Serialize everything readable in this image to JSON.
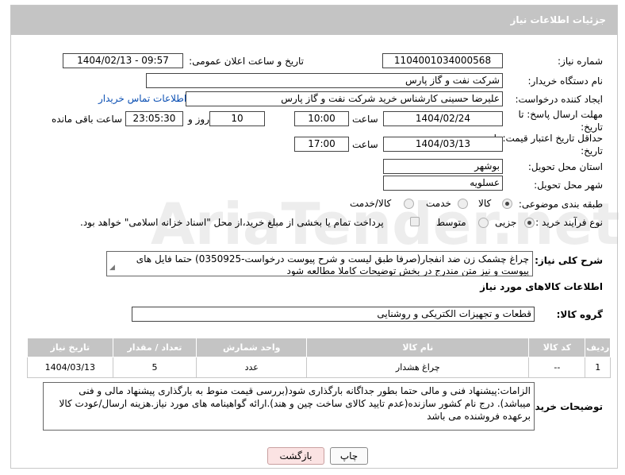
{
  "header": {
    "title": "جزئیات اطلاعات نیاز"
  },
  "watermark": {
    "text": "AriaTender.net"
  },
  "fields": {
    "need_number": {
      "label": "شماره نیاز:",
      "value": "1104001034000568"
    },
    "announce_datetime": {
      "label": "تاریخ و ساعت اعلان عمومی:",
      "value": "1404/02/13 - 09:57"
    },
    "buyer_org": {
      "label": "نام دستگاه خریدار:",
      "value": "شرکت نفت و گاز پارس"
    },
    "requester": {
      "label": "ایجاد کننده درخواست:",
      "value": "علیرضا حسینی کارشناس خرید شرکت نفت و گاز پارس",
      "contact_link": "اطلاعات تماس خریدار"
    },
    "reply_deadline": {
      "label": "مهلت ارسال پاسخ: تا تاریخ:",
      "date": "1404/02/24",
      "time_label": "ساعت",
      "time": "10:00",
      "days": "10",
      "days_label": "روز و",
      "remaining": "23:05:30",
      "remaining_label": "ساعت باقی مانده"
    },
    "price_validity": {
      "label": "حداقل تاریخ اعتبار قیمت: تا تاریخ:",
      "date": "1404/03/13",
      "time_label": "ساعت",
      "time": "17:00"
    },
    "province": {
      "label": "استان محل تحویل:",
      "value": "بوشهر"
    },
    "city": {
      "label": "شهر محل تحویل:",
      "value": "عسلویه"
    },
    "category": {
      "label": "طبقه بندی موضوعی:",
      "options": [
        "کالا",
        "خدمت",
        "کالا/خدمت"
      ],
      "selected": "کالا"
    },
    "purchase_type": {
      "label": "نوع فرآیند خرید :",
      "options": [
        "جزیی",
        "متوسط"
      ],
      "selected": "جزیی",
      "payment_note": "پرداخت تمام یا بخشی از مبلغ خرید،از محل \"اسناد خزانه اسلامی\" خواهد بود."
    }
  },
  "description": {
    "label": "شرح کلی نیاز:",
    "text": "چراغ چشمک زن ضد انفجار(صرفا طبق لیست و شرح پیوست درخواست-0350925) حتما فایل های پیوست و نیز متن مندرج در بخش توضیحات کاملا مطالعه شود"
  },
  "goods": {
    "section_title": "اطلاعات کالاهای مورد نیاز",
    "group_label": "گروه کالا:",
    "group_value": "قطعات و تجهیزات الکتریکی و روشنایی",
    "columns": [
      "ردیف",
      "کد کالا",
      "نام کالا",
      "واحد شمارش",
      "تعداد / مقدار",
      "تاریخ نیاز"
    ],
    "rows": [
      {
        "row": "1",
        "code": "--",
        "name": "چراغ هشدار",
        "unit": "عدد",
        "qty": "5",
        "date": "1404/03/13"
      }
    ]
  },
  "buyer_notes": {
    "label": "توضیحات خریدار:",
    "text": "الزامات:پیشنهاد فنی و مالی حتما  بطور جداگانه بارگذاری شود(بررسی قیمت منوط به بارگذاری پیشنهاد مالی و فنی میباشد). درج نام کشور سازنده(عدم تایید کالای ساخت چین و هند).ارائه گواهینامه های مورد نیاز.هزینه ارسال/عودت کالا برعهده فروشنده می باشد"
  },
  "buttons": {
    "print": "چاپ",
    "back": "بازگشت"
  },
  "colors": {
    "header_bg": "#c4c4c4",
    "link": "#0b4fb3",
    "back_button_bg": "#fbe3e3"
  }
}
